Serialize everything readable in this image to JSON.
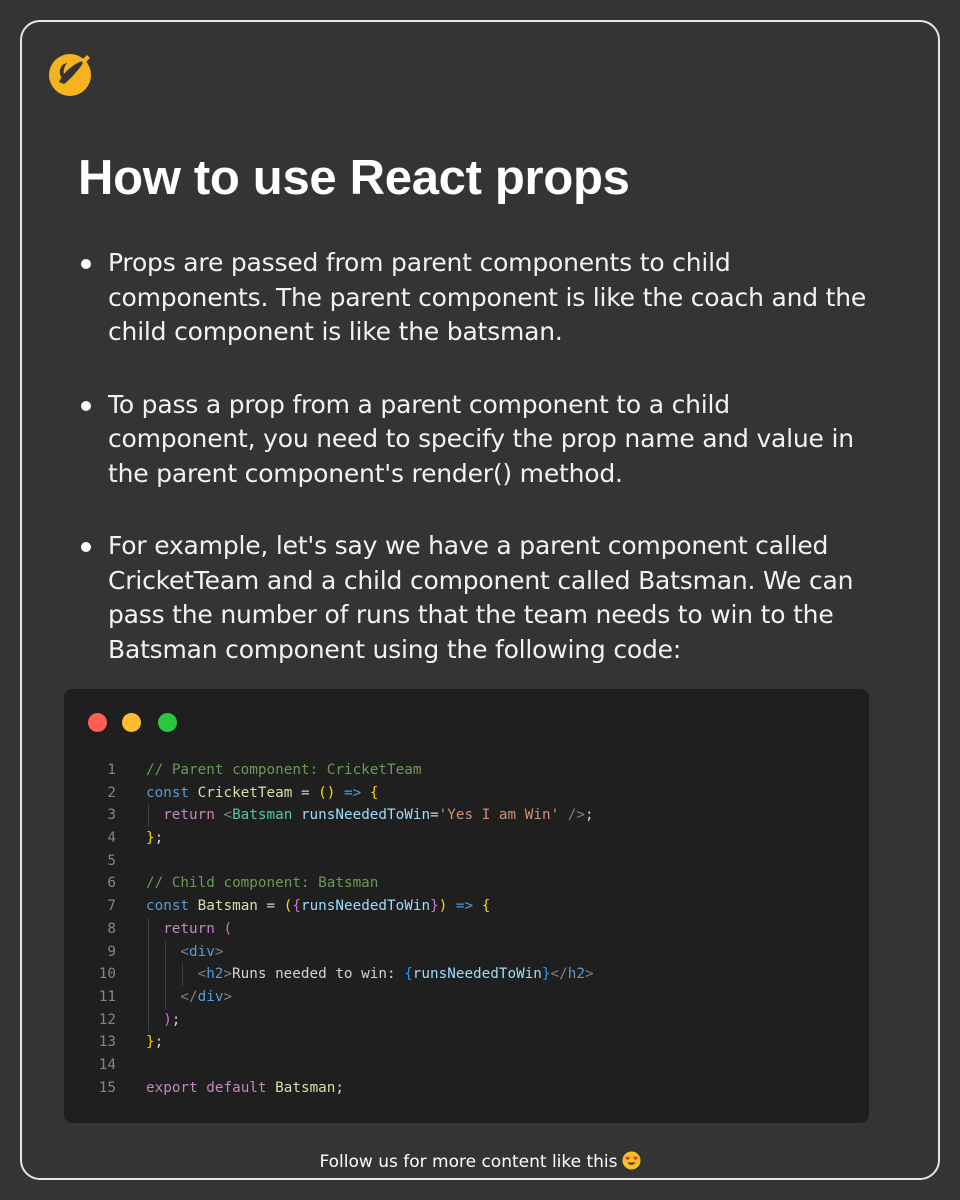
{
  "title": "How to use React props",
  "bullets": [
    "Props are passed from parent components to child components. The parent component is like the coach and the child component is like the batsman.",
    "To pass a prop from a parent component to a child component, you need to specify the prop name and value in the parent component's render() method.",
    "For example, let's say we have a parent component called CricketTeam and a child component called Batsman. We can pass the number of runs that the team needs to win to the Batsman component using the following code:"
  ],
  "editor": {
    "window_dots": [
      {
        "name": "close",
        "color": "#ff5f57"
      },
      {
        "name": "minimize",
        "color": "#febc2e"
      },
      {
        "name": "maximize",
        "color": "#28c840"
      }
    ],
    "lines": [
      {
        "n": "1",
        "indent": 0,
        "tokens": [
          [
            "// Parent component: CricketTeam",
            "comment"
          ]
        ]
      },
      {
        "n": "2",
        "indent": 0,
        "tokens": [
          [
            "const",
            "kw"
          ],
          [
            " ",
            "plain"
          ],
          [
            "CricketTeam",
            "fn"
          ],
          [
            " = ",
            "plain"
          ],
          [
            "()",
            "br1"
          ],
          [
            " ",
            "plain"
          ],
          [
            "=>",
            "kw"
          ],
          [
            " ",
            "plain"
          ],
          [
            "{",
            "br1"
          ]
        ]
      },
      {
        "n": "3",
        "indent": 1,
        "tokens": [
          [
            "return",
            "ctrl"
          ],
          [
            " ",
            "plain"
          ],
          [
            "<",
            "tag"
          ],
          [
            "Batsman",
            "comp"
          ],
          [
            " ",
            "plain"
          ],
          [
            "runsNeededToWin",
            "attr"
          ],
          [
            "=",
            "plain"
          ],
          [
            "'Yes I am Win'",
            "str"
          ],
          [
            " ",
            "plain"
          ],
          [
            "/>",
            "tag"
          ],
          [
            ";",
            "plain"
          ]
        ]
      },
      {
        "n": "4",
        "indent": 0,
        "tokens": [
          [
            "}",
            "br1"
          ],
          [
            ";",
            "plain"
          ]
        ]
      },
      {
        "n": "5",
        "indent": 0,
        "tokens": []
      },
      {
        "n": "6",
        "indent": 0,
        "tokens": [
          [
            "// Child component: Batsman",
            "comment"
          ]
        ]
      },
      {
        "n": "7",
        "indent": 0,
        "tokens": [
          [
            "const",
            "kw"
          ],
          [
            " ",
            "plain"
          ],
          [
            "Batsman",
            "fn"
          ],
          [
            " = ",
            "plain"
          ],
          [
            "(",
            "br1"
          ],
          [
            "{",
            "br2"
          ],
          [
            "runsNeededToWin",
            "attr"
          ],
          [
            "}",
            "br2"
          ],
          [
            ")",
            "br1"
          ],
          [
            " ",
            "plain"
          ],
          [
            "=>",
            "kw"
          ],
          [
            " ",
            "plain"
          ],
          [
            "{",
            "br1"
          ]
        ]
      },
      {
        "n": "8",
        "indent": 1,
        "tokens": [
          [
            "return",
            "ctrl"
          ],
          [
            " ",
            "plain"
          ],
          [
            "(",
            "br2"
          ]
        ]
      },
      {
        "n": "9",
        "indent": 2,
        "tokens": [
          [
            "<",
            "tag"
          ],
          [
            "div",
            "html"
          ],
          [
            ">",
            "tag"
          ]
        ]
      },
      {
        "n": "10",
        "indent": 3,
        "tokens": [
          [
            "<",
            "tag"
          ],
          [
            "h2",
            "html"
          ],
          [
            ">",
            "tag"
          ],
          [
            "Runs needed to win: ",
            "plain"
          ],
          [
            "{",
            "br3"
          ],
          [
            "runsNeededToWin",
            "attr"
          ],
          [
            "}",
            "br3"
          ],
          [
            "</",
            "tag"
          ],
          [
            "h2",
            "html"
          ],
          [
            ">",
            "tag"
          ]
        ]
      },
      {
        "n": "11",
        "indent": 2,
        "tokens": [
          [
            "</",
            "tag"
          ],
          [
            "div",
            "html"
          ],
          [
            ">",
            "tag"
          ]
        ]
      },
      {
        "n": "12",
        "indent": 1,
        "tokens": [
          [
            ")",
            "br2"
          ],
          [
            ";",
            "plain"
          ]
        ]
      },
      {
        "n": "13",
        "indent": 0,
        "tokens": [
          [
            "}",
            "br1"
          ],
          [
            ";",
            "plain"
          ]
        ]
      },
      {
        "n": "14",
        "indent": 0,
        "tokens": []
      },
      {
        "n": "15",
        "indent": 0,
        "tokens": [
          [
            "export",
            "ctrl"
          ],
          [
            " ",
            "plain"
          ],
          [
            "default",
            "ctrl"
          ],
          [
            " ",
            "plain"
          ],
          [
            "Batsman",
            "fn"
          ],
          [
            ";",
            "plain"
          ]
        ]
      }
    ]
  },
  "footer": {
    "text": "Follow us for more content like this",
    "emoji_icon": "heart-eyes-emoji-icon"
  },
  "colors": {
    "background": "#343434",
    "logo": "#f5b41e",
    "editor_background": "#1f1f1f"
  }
}
